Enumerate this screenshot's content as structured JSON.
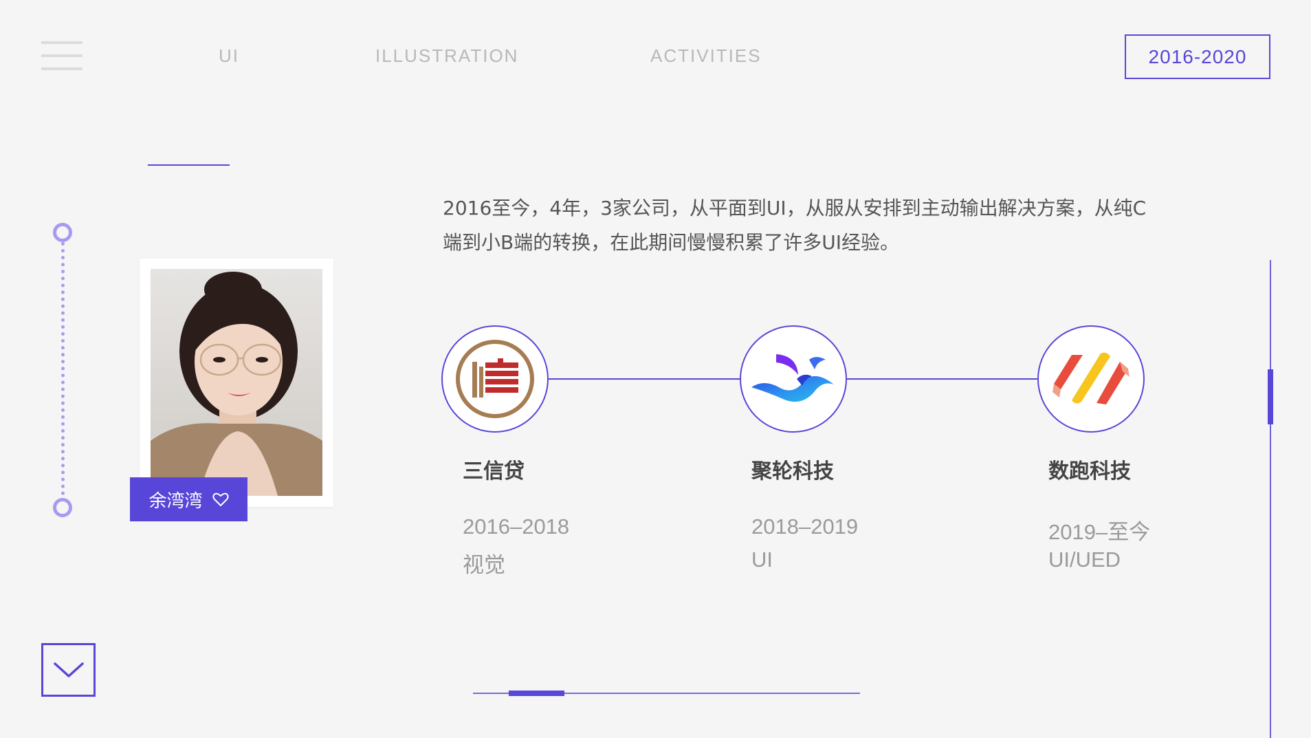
{
  "nav": {
    "menu_icon": "hamburger-icon",
    "items": [
      "UI",
      "ILLUSTRATION",
      "ACTIVITIES"
    ],
    "year_range": "2016-2020"
  },
  "profile": {
    "name": "余湾湾",
    "heart_icon": "heart-icon"
  },
  "intro": {
    "line1": "2016至今，4年，3家公司，从平面到UI，从服从安排到主动输出解决方案，从纯C",
    "line2": "端到小B端的转换，在此期间慢慢积累了许多UI经验。"
  },
  "companies": [
    {
      "name": "三信贷",
      "years": "2016–2018",
      "role": "视觉"
    },
    {
      "name": "聚轮科技",
      "years": "2018–2019",
      "role": "UI"
    },
    {
      "name": "数跑科技",
      "years": "2019–至今",
      "role": "UI/UED"
    }
  ],
  "colors": {
    "accent": "#5846d8",
    "timeline": "#a99af0",
    "background": "#f5f5f5"
  },
  "controls": {
    "down_icon": "chevron-down-icon",
    "pager_current": 1,
    "pager_total": 7
  }
}
